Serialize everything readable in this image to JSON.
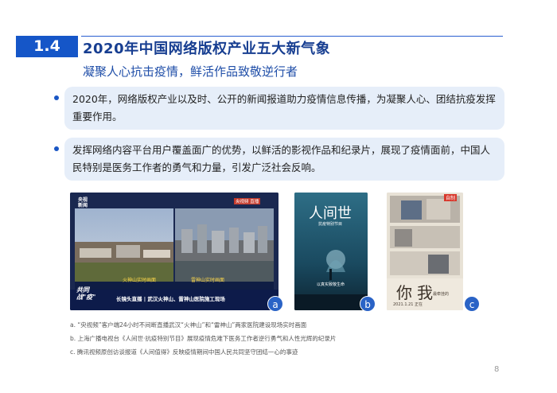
{
  "header": {
    "section_number": "1.4",
    "title": "2020年中国网络版权产业五大新气象",
    "subtitle": "凝聚人心抗击疫情，鲜活作品致敬逆行者"
  },
  "bullets": [
    {
      "text": "2020年，网络版权产业以及时、公开的新闻报道助力疫情信息传播，为凝聚人心、团结抗疫发挥重要作用。"
    },
    {
      "text": "发挥网络内容平台用户覆盖面广的优势，以鲜活的影视作品和纪录片，展现了疫情面前，中国人民特别是医务工作者的勇气和力量，引发广泛社会反响。"
    }
  ],
  "images": {
    "a": {
      "badge": "a",
      "logo": "央视\n新闻",
      "live_tag": "央视频 直播",
      "label_left": "火神山实时画面",
      "label_right": "雷神山实时画面",
      "corner_text": "共同\n战\"疫\"",
      "ticker": "长镜头直播 | 武汉火神山、雷神山医院施工现场"
    },
    "b": {
      "badge": "b",
      "title_art": "人间世",
      "subtitle_art": "抗疫特别节目",
      "bottom_text": "以真实致敬生命"
    },
    "c": {
      "badge": "c",
      "tag": "自制",
      "title_art": "你我",
      "subtitle_art": "最牵挂的",
      "date_text": "2021.1.21 正在"
    }
  },
  "captions": [
    "a. “央视频”客户端24小时不间断直播武汉“火神山”和“雷神山”两家医院建设现场实时画面",
    "b. 上海广播电视台《人间世·抗疫特别节目》展现疫情危难下医务工作者逆行勇气和人性光辉的纪录片",
    "c. 腾讯视频原创访谈报道《人间值得》反映疫情期间中国人民共同坚守团结一心的事迹"
  ],
  "page_number": "8",
  "colors": {
    "accent": "#1556c8",
    "title": "#173e91",
    "card_bg": "#e6eef9"
  }
}
